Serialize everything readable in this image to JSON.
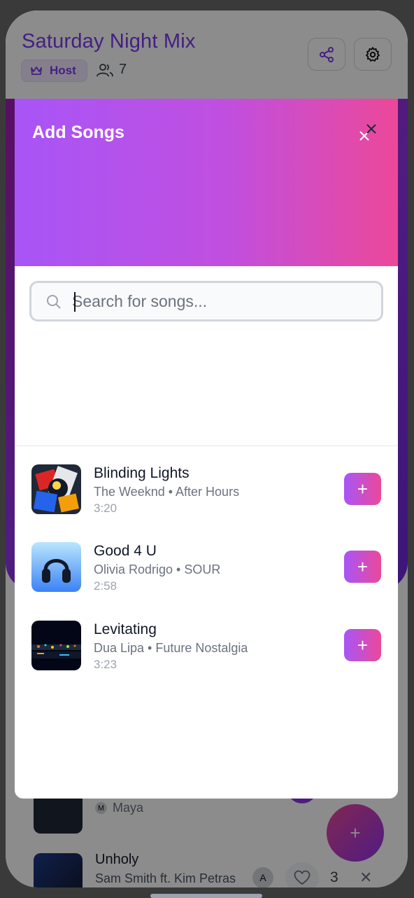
{
  "app": {
    "title": "Saturday Night Mix",
    "host_label": "Host",
    "member_count": "7",
    "share_icon": "share-icon",
    "settings_icon": "gear-icon"
  },
  "background_queue": {
    "partial_item_requester": "Maya",
    "partial_item_requester_initial": "M",
    "next_song": {
      "title": "Unholy",
      "artist": "Sam Smith ft. Kim Petras",
      "requester_initial": "A",
      "votes": "3"
    },
    "fab_label": "+"
  },
  "modal": {
    "title": "Add Songs",
    "close_icon": "close-icon",
    "search_placeholder": "Search for songs...",
    "add_label": "+",
    "results": [
      {
        "title": "Blinding Lights",
        "meta": "The Weeknd • After Hours",
        "duration": "3:20"
      },
      {
        "title": "Good 4 U",
        "meta": "Olivia Rodrigo • SOUR",
        "duration": "2:58"
      },
      {
        "title": "Levitating",
        "meta": "Dua Lipa • Future Nostalgia",
        "duration": "3:23"
      }
    ]
  },
  "colors": {
    "accent_purple": "#a855f7",
    "accent_pink": "#ec4899",
    "brand_violet": "#7c3aed"
  }
}
